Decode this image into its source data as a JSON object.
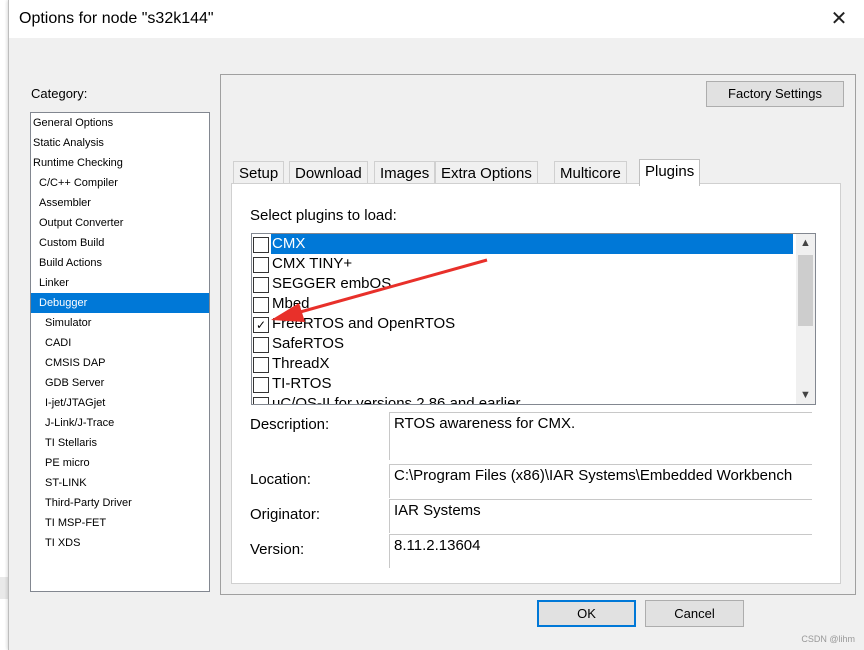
{
  "window": {
    "title": "Options for node \"s32k144\"",
    "close_glyph": "✕"
  },
  "category": {
    "label": "Category:",
    "items": [
      {
        "label": "General Options",
        "level": 0
      },
      {
        "label": "Static Analysis",
        "level": 0
      },
      {
        "label": "Runtime Checking",
        "level": 0
      },
      {
        "label": "C/C++ Compiler",
        "level": 1
      },
      {
        "label": "Assembler",
        "level": 1
      },
      {
        "label": "Output Converter",
        "level": 1
      },
      {
        "label": "Custom Build",
        "level": 1
      },
      {
        "label": "Build Actions",
        "level": 1
      },
      {
        "label": "Linker",
        "level": 1
      },
      {
        "label": "Debugger",
        "level": 1,
        "selected": true
      },
      {
        "label": "Simulator",
        "level": 2
      },
      {
        "label": "CADI",
        "level": 2
      },
      {
        "label": "CMSIS DAP",
        "level": 2
      },
      {
        "label": "GDB Server",
        "level": 2
      },
      {
        "label": "I-jet/JTAGjet",
        "level": 2
      },
      {
        "label": "J-Link/J-Trace",
        "level": 2
      },
      {
        "label": "TI Stellaris",
        "level": 2
      },
      {
        "label": "PE micro",
        "level": 2
      },
      {
        "label": "ST-LINK",
        "level": 2
      },
      {
        "label": "Third-Party Driver",
        "level": 2
      },
      {
        "label": "TI MSP-FET",
        "level": 2
      },
      {
        "label": "TI XDS",
        "level": 2
      }
    ]
  },
  "factory_settings_label": "Factory Settings",
  "tabs": [
    {
      "label": "Setup"
    },
    {
      "label": "Download"
    },
    {
      "label": "Images"
    },
    {
      "label": "Extra Options"
    },
    {
      "label": "Multicore"
    },
    {
      "label": "Plugins",
      "active": true
    }
  ],
  "plugins": {
    "label": "Select plugins to load:",
    "items": [
      {
        "label": "CMX",
        "checked": false,
        "selected": true
      },
      {
        "label": "CMX TINY+",
        "checked": false
      },
      {
        "label": "SEGGER embOS",
        "checked": false
      },
      {
        "label": "Mbed",
        "checked": false
      },
      {
        "label": "FreeRTOS and OpenRTOS",
        "checked": true
      },
      {
        "label": "SafeRTOS",
        "checked": false
      },
      {
        "label": "ThreadX",
        "checked": false
      },
      {
        "label": "TI-RTOS",
        "checked": false
      },
      {
        "label": "uC/OS-II for versions 2.86 and earlier",
        "checked": false
      }
    ],
    "check_glyph": "✓"
  },
  "details": {
    "description_label": "Description:",
    "description_value": "RTOS awareness for CMX.",
    "location_label": "Location:",
    "location_value": "C:\\Program Files (x86)\\IAR Systems\\Embedded Workbench",
    "originator_label": "Originator:",
    "originator_value": "IAR Systems",
    "version_label": "Version:",
    "version_value": "8.11.2.13604"
  },
  "buttons": {
    "ok": "OK",
    "cancel": "Cancel"
  },
  "watermark": "CSDN @lihm",
  "colors": {
    "selection": "#0078d7",
    "annotation_arrow": "#e8302a"
  }
}
